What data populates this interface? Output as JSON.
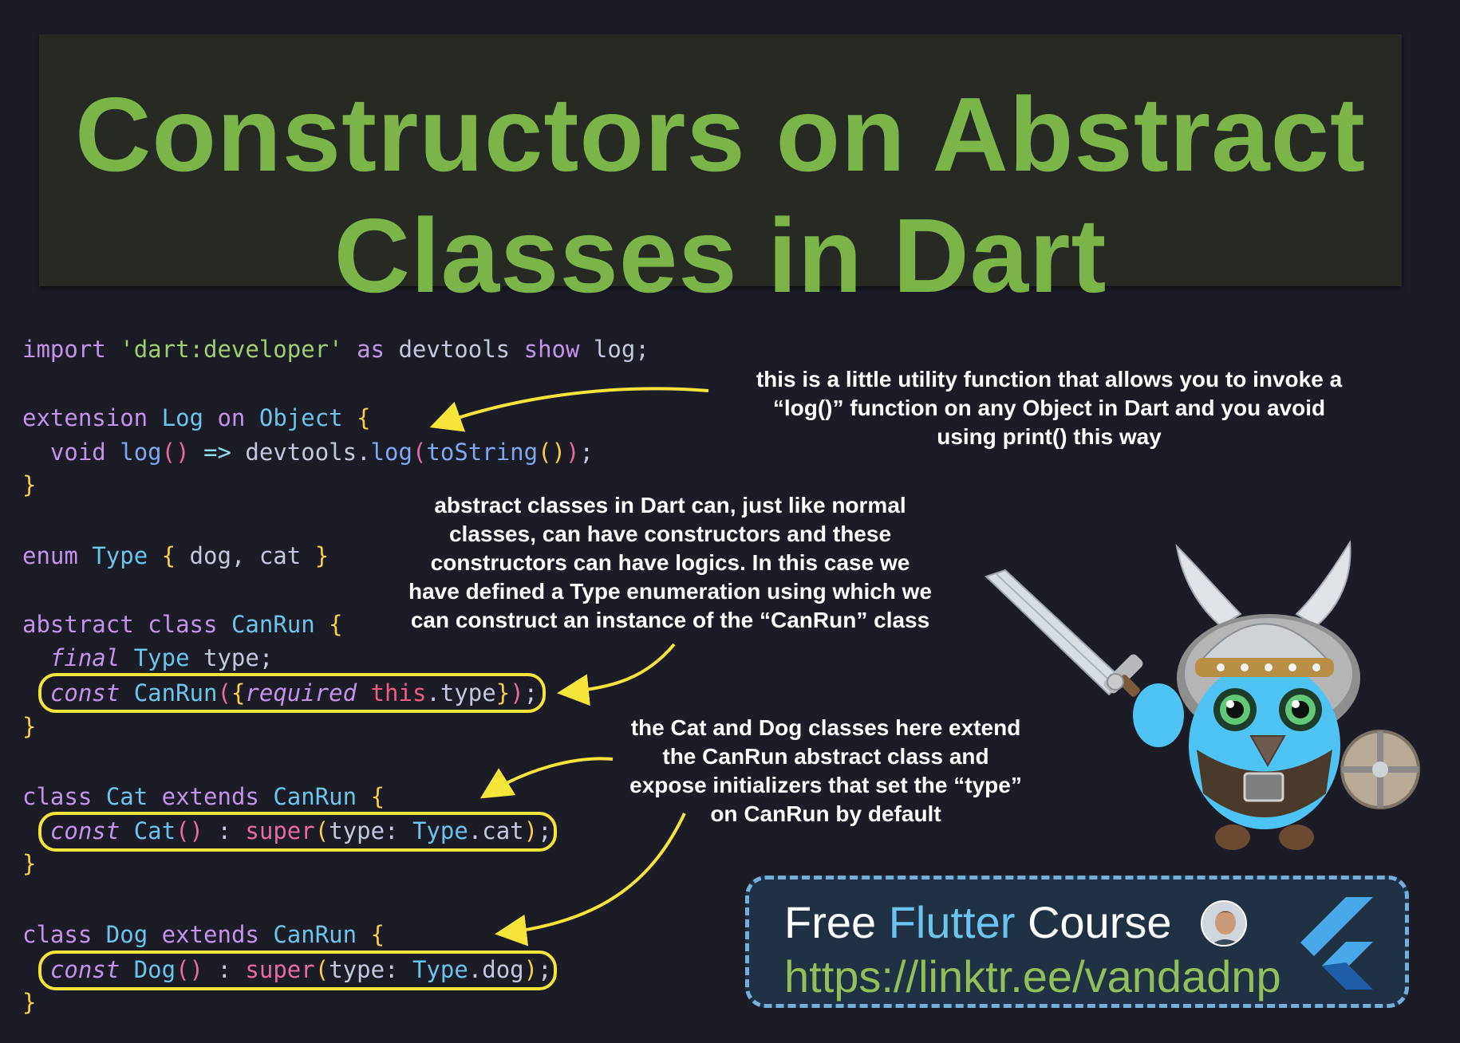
{
  "title": {
    "line1": "Constructors on Abstract",
    "line2": "Classes in Dart"
  },
  "code": {
    "import": {
      "kw_import": "import",
      "path": "'dart:developer'",
      "kw_as": "as",
      "alias": "devtools",
      "kw_show": "show",
      "name": "log",
      "end": ";"
    },
    "extension": {
      "kw_extension": "extension",
      "name": "Log",
      "kw_on": "on",
      "type": "Object",
      "open": "{",
      "kw_void": "void",
      "method": "log",
      "parens": "()",
      "arrow": "=>",
      "target": "devtools.",
      "call": "log",
      "paren_open": "(",
      "inner": "toString",
      "inner_parens": "()",
      "paren_close": ")",
      "end": ";",
      "close": "}"
    },
    "enum": {
      "kw_enum": "enum",
      "name": "Type",
      "open": "{",
      "values": " dog, cat ",
      "close": "}"
    },
    "canrun": {
      "kw_abstract": "abstract",
      "kw_class": "class",
      "name": "CanRun",
      "open": "{",
      "kw_final": "final",
      "field_type": "Type",
      "field_name": " type;",
      "kw_const": "const",
      "ctor": "CanRun",
      "paren_open": "(",
      "brace_open": "{",
      "kw_required": "required",
      "kw_this": "this",
      "param": ".type",
      "brace_close": "}",
      "paren_close": ")",
      "end": ";",
      "close": "}"
    },
    "cat": {
      "kw_class": "class",
      "name": "Cat",
      "kw_extends": "extends",
      "parent": "CanRun",
      "open": "{",
      "kw_const": "const",
      "ctor": "Cat",
      "parens": "()",
      "colon": " : ",
      "kw_super": "super",
      "paren_open": "(",
      "arg": "type: ",
      "enum_type": "Type",
      "enum_value": ".cat",
      "paren_close": ")",
      "end": ";",
      "close": "}"
    },
    "dog": {
      "kw_class": "class",
      "name": "Dog",
      "kw_extends": "extends",
      "parent": "CanRun",
      "open": "{",
      "kw_const": "const",
      "ctor": "Dog",
      "parens": "()",
      "colon": " : ",
      "kw_super": "super",
      "paren_open": "(",
      "arg": "type: ",
      "enum_type": "Type",
      "enum_value": ".dog",
      "paren_close": ")",
      "end": ";",
      "close": "}"
    }
  },
  "notes": {
    "extension_note": "this is a little utility function that allows you to invoke a\n“log()” function on any Object in Dart and you avoid\nusing print() this way",
    "abstract_note": "abstract classes in Dart can, just like normal\nclasses, can have constructors and these\nconstructors can have logics. In this case we\nhave defined a Type enumeration using which we\ncan construct an instance of the “CanRun” class",
    "subclass_note": "the Cat and Dog classes here extend\nthe CanRun abstract class and\nexpose initializers that set the “type”\non CanRun by default"
  },
  "course": {
    "free": "Free ",
    "flutter": "Flutter",
    "course": " Course",
    "url": "https://linktr.ee/vandadnp"
  },
  "colors": {
    "background": "#1b1c26",
    "title_green": "#7cb44a",
    "highlight_yellow": "#f5e43a",
    "keyword": "#c592ea",
    "type": "#6cc4e8",
    "string": "#9fcf70",
    "course_border": "#76aeda"
  }
}
